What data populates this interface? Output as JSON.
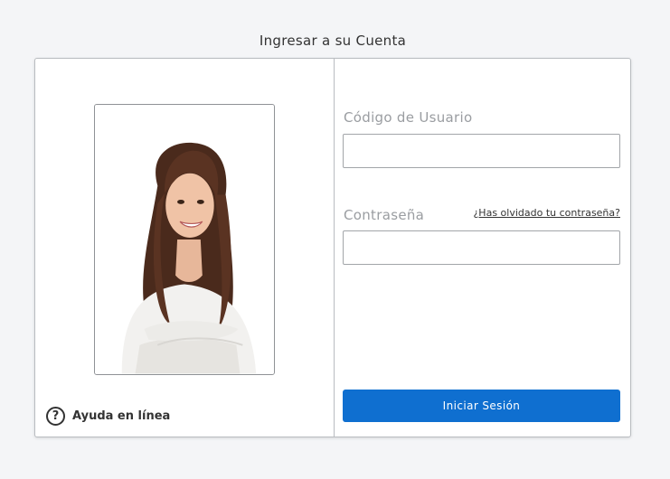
{
  "page": {
    "title": "Ingresar a su Cuenta"
  },
  "left_panel": {
    "photo": "woman-portrait",
    "help": {
      "icon": "question-circle-icon",
      "label": "Ayuda en línea"
    }
  },
  "login_form": {
    "username": {
      "label": "Código de Usuario",
      "value": ""
    },
    "password": {
      "label": "Contraseña",
      "value": "",
      "forgot_link": "¿Has olvidado tu contraseña?"
    },
    "submit_label": "Iniciar Sesión"
  },
  "colors": {
    "primary_button": "#0f6fd0",
    "background": "#f4f5f7",
    "label_gray": "#9a9da1"
  }
}
